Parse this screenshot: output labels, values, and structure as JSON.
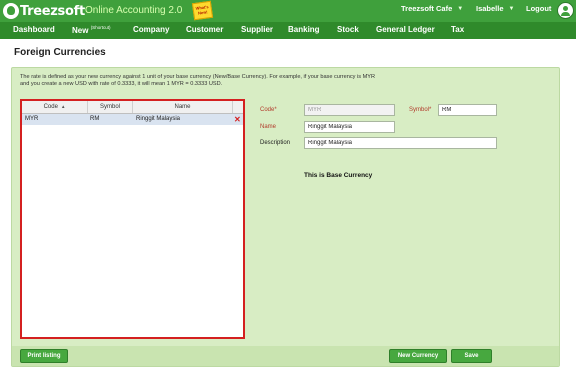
{
  "header": {
    "brand": "Treezsoft",
    "product": "Online Accounting 2.0",
    "whats_new": "What's New!",
    "company": "Treezsoft Cafe",
    "user": "Isabelle",
    "logout": "Logout"
  },
  "nav": {
    "dashboard": "Dashboard",
    "new": "New",
    "new_sup": "(Shortcut)",
    "company": "Company",
    "customer": "Customer",
    "supplier": "Supplier",
    "banking": "Banking",
    "stock": "Stock",
    "general_ledger": "General Ledger",
    "tax": "Tax"
  },
  "page": {
    "title": "Foreign Currencies",
    "info": "The rate is defined as your new currency against 1 unit of your base currency (New/Base Currency). For example, if your base currency is MYR and you create a new USD with rate of 0.3333, it will mean 1 MYR = 0.3333 USD."
  },
  "list": {
    "columns": {
      "code": "Code",
      "symbol": "Symbol",
      "name": "Name"
    },
    "rows": [
      {
        "code": "MYR",
        "symbol": "RM",
        "name": "Ringgit Malaysia"
      }
    ]
  },
  "form": {
    "code_label": "Code*",
    "code_value": "MYR",
    "symbol_label": "Symbol*",
    "symbol_value": "RM",
    "name_label": "Name",
    "name_value": "Ringgit Malaysia",
    "description_label": "Description",
    "description_value": "Ringgit Malaysia",
    "base_note": "This is Base Currency"
  },
  "buttons": {
    "print": "Print listing",
    "new_currency": "New Currency",
    "save": "Save"
  },
  "colors": {
    "topbar": "#3fa03c",
    "navbar": "#2f8a2b",
    "panel": "#d8edc4",
    "highlight_border": "#d42020",
    "button": "#47a83f"
  }
}
